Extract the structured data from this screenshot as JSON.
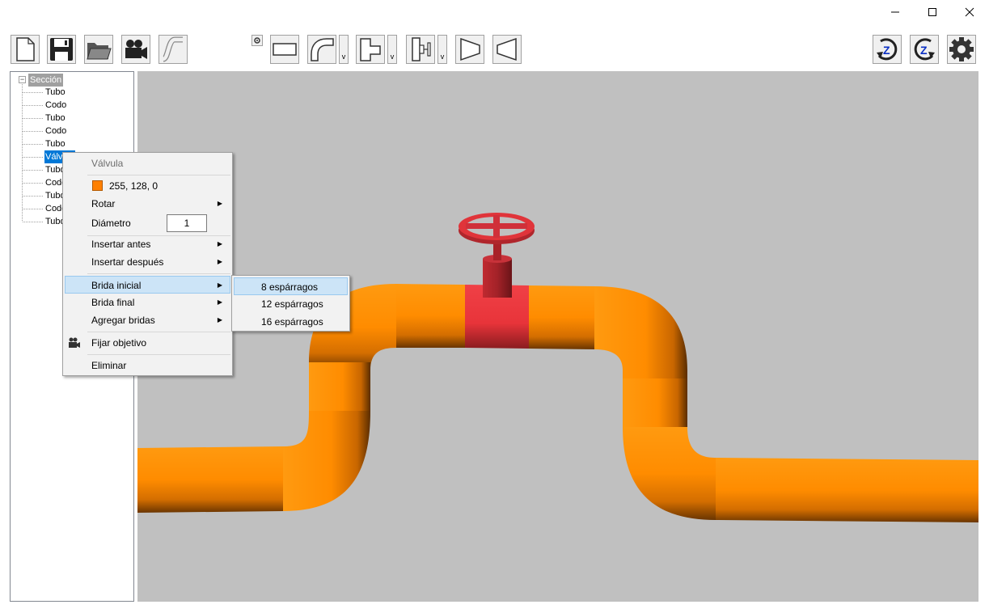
{
  "window": {
    "minimize_icon": "minimize-icon",
    "maximize_icon": "maximize-icon",
    "close_icon": "close-icon"
  },
  "toolbar": {
    "left_buttons": [
      "new-file-icon",
      "save-icon",
      "open-folder-icon",
      "camera-icon",
      "curve-tool-icon"
    ],
    "shape_buttons": [
      "settings-small-icon",
      "tube-icon",
      "elbow-icon",
      "tee-icon",
      "valve-icon",
      "reducer-icon",
      "reducer-reverse-icon"
    ],
    "right_buttons": [
      "rotate-z-cw-icon",
      "rotate-z-ccw-icon",
      "settings-gear-icon"
    ],
    "rotate_label": "Z",
    "dropdown_glyph": "v"
  },
  "tree": {
    "root_label": "Sección",
    "expander": "−",
    "items": [
      "Tubo",
      "Codo",
      "Tubo",
      "Codo",
      "Tubo",
      "Válvula",
      "Tubo",
      "Codo",
      "Tubo",
      "Codo",
      "Tubo"
    ],
    "selected_index": 5
  },
  "context_menu": {
    "header": "Válvula",
    "color_label": "255, 128, 0",
    "color_hex": "#ff8000",
    "rotate": "Rotar",
    "diameter_label": "Diámetro",
    "diameter_value": "1",
    "insert_before": "Insertar antes",
    "insert_after": "Insertar después",
    "start_flange": "Brida inicial",
    "end_flange": "Brida final",
    "add_flanges": "Agregar bridas",
    "set_target": "Fijar objetivo",
    "delete": "Eliminar"
  },
  "submenu": {
    "items": [
      "8 espárragos",
      "12 espárragos",
      "16 espárragos"
    ],
    "highlighted_index": 0
  },
  "scene": {
    "pipe_color": "#ff8c00",
    "valve_color": "#e8343a",
    "background": "#c0c0c0"
  }
}
